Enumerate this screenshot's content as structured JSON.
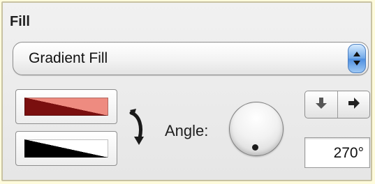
{
  "panel": {
    "title": "Fill"
  },
  "fill_type": {
    "selected": "Gradient Fill",
    "icon": "stepper-arrows-icon"
  },
  "gradient": {
    "start_color": {
      "primary": "#7a0f0f",
      "secondary": "#ee8b80"
    },
    "end_color": {
      "primary": "#000000",
      "secondary": "#ffffff"
    },
    "swap_icon": "swap-arrows-icon"
  },
  "angle": {
    "label": "Angle:",
    "value": "270°",
    "degrees": 270
  },
  "direction_buttons": {
    "down_icon": "arrow-down-icon",
    "right_icon": "arrow-right-icon"
  }
}
